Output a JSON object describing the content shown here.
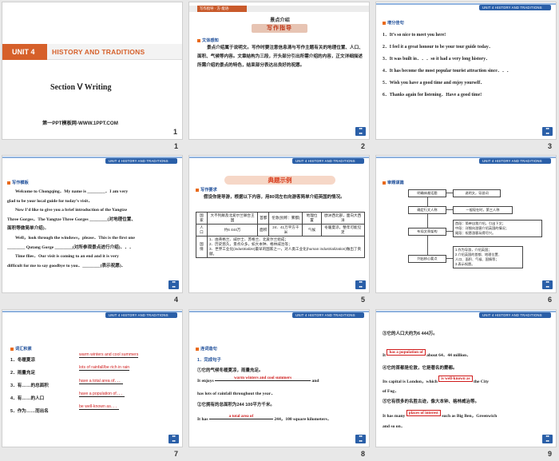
{
  "slides": [
    {
      "num": "1",
      "unit": "UNIT 4",
      "title": "HISTORY AND TRADITIONS",
      "section": "Section Ⅴ Writing",
      "footer": "第一PPT模板网-WWW.1PPT.COM"
    },
    {
      "num": "2",
      "header": "写作指导 · 方·能语·",
      "heading": "景点介绍",
      "subheading": "写作指导",
      "label": "文体感知",
      "body": "景点介绍属于说明文。写作时要注意信息清与写作主题有关的地理位置、人口、面积、气候等内容。文章结构为三段，开头部分引出所需介绍的内容，正文详细描述所需介绍的景点的特色，结束部分表达出良好的祝愿。"
    },
    {
      "num": "3",
      "header": "UNIT 4 HISTORY AND TRADITIONS",
      "label": "增分佳句",
      "items": [
        "1．It’s so nice to meet you here!",
        "2．I feel it a great honour to be your tour guide today．",
        "3．It was built in．．．so it had a very long history．",
        "4．It has become the most popular tourist attraction since．．．",
        "5．Wish you have a good time and enjoy yourself．",
        "6．Thanks again for listening．Have a good time!"
      ]
    },
    {
      "num": "4",
      "header": "UNIT 4 HISTORY AND TRADITIONS",
      "label": "写作模板",
      "lines": [
        "Welcome to Chongqing．My name is ________．I am very",
        "glad to be your local guide for today’s visit．",
        "Now I’d like to give you a brief introduction of the Yangtze",
        "Three Gorges．The Yangtze Three Gorges ________(对地理位置、",
        "面积等做简单介绍)．",
        "Well，look through the windows，please．This is the first one",
        "________ Qutang Gorge ________(对所参观景点进行介绍)．．．",
        "Time flies．Our visit is coming to an end and it is very",
        "difficult for me to say goodbye to you．________(表示祝愿)．"
      ]
    },
    {
      "num": "5",
      "header": "UNIT 4 HISTORY AND TRADITIONS",
      "banner": "典题示例",
      "label": "写作要求",
      "intro": "假设你是导游，根据以下内容，用80词左右向游客简单介绍英国的情况。",
      "table": {
        "row1": [
          "国家",
          "大不列颠及北爱尔兰联合王国",
          "首都",
          "伦敦(别称：雾都)",
          "地理位置",
          "欧洲西北部，面向大西洋"
        ],
        "row2": [
          "人口",
          "约6 444万",
          "面积",
          "24．41万平方千米",
          "气候",
          "冬暖夏凉，整年可能见足"
        ],
        "row3_head": "国情",
        "row3": [
          "1．由英格兰、威尔士、苏格兰、北爱尔兰组成；",
          "2．历史悠久，景点众多，如大本钟、格林威治等；",
          "3．世界工业化(industrialize)最早的国家之一，对人类工业化(human industrialization)做出了贡献。"
        ]
      }
    },
    {
      "num": "6",
      "header": "UNIT 4 HISTORY AND TRADITIONS",
      "label": "审题谋篇",
      "flow_left": [
        "明确体裁话题",
        "确定行文人称",
        "布局文章架构",
        "列出核心要点"
      ],
      "flow_right": [
        "说明文，导游词",
        "一般现在时，第三人称",
        "首段：简单自我介绍，引出下文；\n中段：详细向游客介绍英国的情况；\n尾段：祝愿游客玩得尽兴。",
        "1.作为导游，介绍英国；\n2.介绍英国的首都、地理位置、\n人口、面积、气候、国情等；\n3.表示祝愿。"
      ]
    },
    {
      "num": "7",
      "header": "UNIT 4 HISTORY AND TRADITIONS",
      "label": "词汇积累",
      "items": [
        {
          "cn": "1．冬暖夏凉",
          "ans": "warm winters and cool summers"
        },
        {
          "cn": "2．雨量充足",
          "ans": "lots of rainfall/be rich in rain"
        },
        {
          "cn": "3．有……的总面积",
          "ans": "have a total area of．．．"
        },
        {
          "cn": "4．有……的人口",
          "ans": "have a population of．．．"
        },
        {
          "cn": "5．作为……而出名",
          "ans": "be well-known as．．．"
        }
      ]
    },
    {
      "num": "8",
      "header": "UNIT 4 HISTORY AND TRADITIONS",
      "label": "连词造句",
      "sub": "1．完成句子",
      "s1_cn": "①它的气候冬暖夏凉，雨量充足。",
      "s1_a": "It enjoys",
      "s1_ans": "warm winters and cool summers",
      "s1_b": "and",
      "s1_c": "has lots of rainfall throughout the year．",
      "s2_cn": "②它拥有的总面积为244 100平方千米。",
      "s2_a": "It has",
      "s2_ans": "a total area of",
      "s2_b": "244，100 square kilometers．"
    },
    {
      "num": "9",
      "header": "UNIT 4 HISTORY AND TRADITIONS",
      "s3_cn": "③它的人口大约为6 444万。",
      "s3_a": "It",
      "s3_ans": "has a population of",
      "s3_b": "about 64．44 million．",
      "s4_cn": "④它的首都是伦敦，它是著名的雾都。",
      "s4_a": "Its capital is London，which",
      "s4_ans": "is well-known as",
      "s4_b": "the City",
      "s4_c": "of Fog．",
      "s5_cn": "⑤它有很多的名胜古迹，像大本钟、格林威治等。",
      "s5_a": "It has many",
      "s5_ans": "places of interest",
      "s5_b": "such as Big Ben，Greenwich",
      "s5_c": "and so on．"
    }
  ],
  "colors": {
    "accent": "#2a5fa8",
    "answer": "#d01c1c",
    "label": "#1f4f9a",
    "banner_bg": "#f6d7c7"
  },
  "icon_corner": "book-icon"
}
